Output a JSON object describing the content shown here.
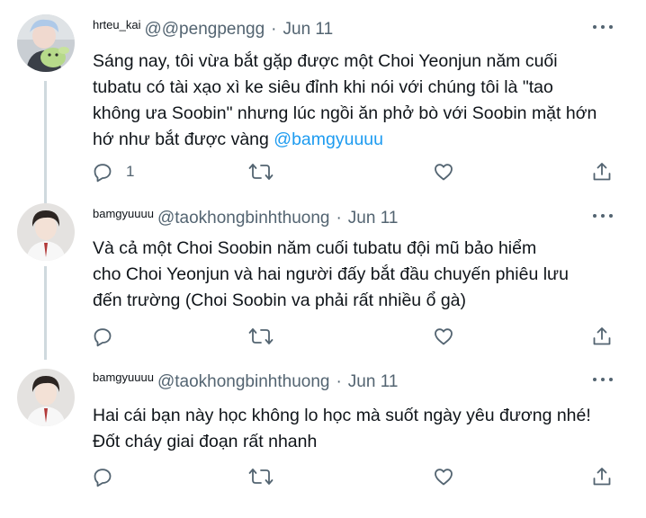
{
  "tweets": [
    {
      "display_name": "hrteu_kai",
      "handle": "@@pengpengg",
      "separator": "·",
      "date": "Jun 11",
      "text_lines": [
        "Sáng nay, tôi vừa bắt gặp được một Choi Yeonjun năm cuối",
        "tubatu có tài xạo xì ke siêu đỉnh khi nói với chúng tôi là \"tao",
        "không ưa Soobin\" nhưng lúc ngồi ăn phở bò với Soobin mặt hớn",
        "hớ như bắt được vàng "
      ],
      "mention": "@bamgyuuuu",
      "reply_count": "1",
      "avatar_icon": "avatar-green-plush"
    },
    {
      "display_name": "bamgyuuuu",
      "handle": "@taokhongbinhthuong",
      "separator": "·",
      "date": "Jun 11",
      "text_lines": [
        "Và cả một Choi Soobin năm cuối tubatu đội mũ bảo hiểm",
        "cho Choi Yeonjun và hai người đấy bắt đầu chuyến phiêu lưu",
        "đến trường (Choi Soobin va phải rất nhiều ổ gà)"
      ],
      "reply_count": "",
      "avatar_icon": "avatar-boy-uniform"
    },
    {
      "display_name": "bamgyuuuu",
      "handle": "@taokhongbinhthuong",
      "separator": "·",
      "date": "Jun 11",
      "text_lines": [
        "Hai cái bạn này học không lo học mà suốt ngày yêu đương nhé!",
        "Đốt cháy giai đoạn rất nhanh"
      ],
      "reply_count": "",
      "avatar_icon": "avatar-boy-uniform"
    }
  ],
  "action_icons": [
    "reply-icon",
    "retweet-icon",
    "like-icon",
    "share-icon"
  ],
  "colors": {
    "text": "#0f1419",
    "secondary": "#536471",
    "link": "#1d9bf0",
    "thread_line": "#cfd9de"
  }
}
